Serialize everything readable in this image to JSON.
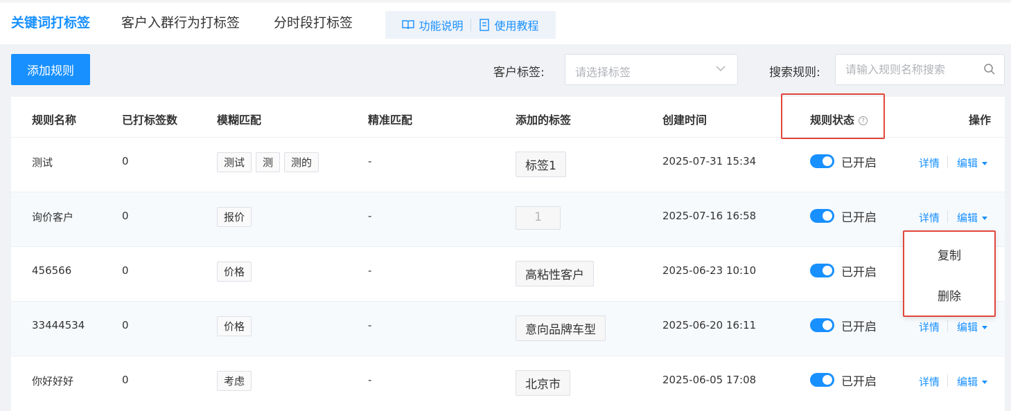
{
  "tabs": [
    {
      "label": "关键词打标签",
      "active": true
    },
    {
      "label": "客户入群行为打标签",
      "active": false
    },
    {
      "label": "分时段打标签",
      "active": false
    }
  ],
  "help": {
    "feature_label": "功能说明",
    "tutorial_label": "使用教程"
  },
  "toolbar": {
    "add_label": "添加规则",
    "customer_tag_label": "客户标签:",
    "customer_tag_placeholder": "请选择标签",
    "search_label": "搜索规则:",
    "search_placeholder": "请输入规则名称搜索"
  },
  "table": {
    "headers": {
      "name": "规则名称",
      "tagged_count": "已打标签数",
      "fuzzy": "模糊匹配",
      "exact": "精准匹配",
      "added_tags": "添加的标签",
      "created": "创建时间",
      "status": "规则状态",
      "ops": "操作"
    },
    "rows": [
      {
        "name": "测试",
        "count": "0",
        "fuzzy": [
          "测试",
          "测",
          "测的"
        ],
        "exact": "-",
        "tag": "标签1",
        "created": "2025-07-31 15:34",
        "status": "已开启"
      },
      {
        "name": "询价客户",
        "count": "0",
        "fuzzy": [
          "报价"
        ],
        "exact": "-",
        "tag": "1",
        "created": "2025-07-16 16:58",
        "status": "已开启"
      },
      {
        "name": "456566",
        "count": "0",
        "fuzzy": [
          "价格"
        ],
        "exact": "-",
        "tag": "高粘性客户",
        "created": "2025-06-23 10:10",
        "status": "已开启"
      },
      {
        "name": "33444534",
        "count": "0",
        "fuzzy": [
          "价格"
        ],
        "exact": "-",
        "tag": "意向品牌车型",
        "created": "2025-06-20 16:11",
        "status": "已开启"
      },
      {
        "name": "你好好好",
        "count": "0",
        "fuzzy": [
          "考虑"
        ],
        "exact": "-",
        "tag": "北京市",
        "created": "2025-06-05 17:08",
        "status": "已开启"
      }
    ],
    "op_detail": "详情",
    "op_edit": "编辑"
  },
  "dropdown": {
    "copy": "复制",
    "delete": "删除"
  },
  "colors": {
    "accent": "#1890ff",
    "highlight_border": "#e0463a"
  }
}
